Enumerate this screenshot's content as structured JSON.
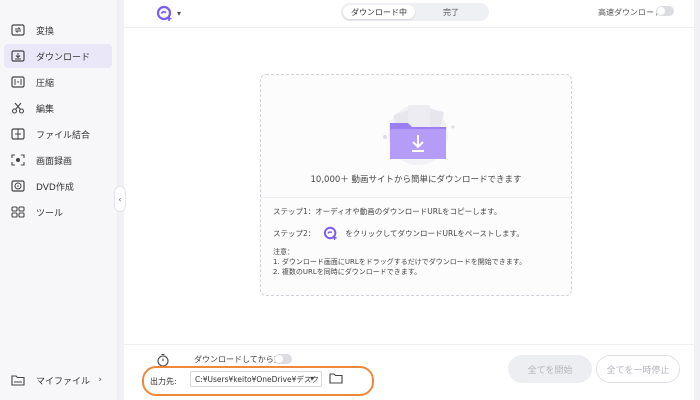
{
  "sidebar": {
    "items": [
      {
        "label": "変換",
        "icon": "convert-icon"
      },
      {
        "label": "ダウンロード",
        "icon": "download-icon",
        "active": true
      },
      {
        "label": "圧縮",
        "icon": "compress-icon"
      },
      {
        "label": "編集",
        "icon": "scissors-icon"
      },
      {
        "label": "ファイル結合",
        "icon": "merge-icon"
      },
      {
        "label": "画面録画",
        "icon": "screen-record-icon"
      },
      {
        "label": "DVD作成",
        "icon": "dvd-icon"
      },
      {
        "label": "ツール",
        "icon": "tools-icon"
      }
    ],
    "my_files": {
      "label": "マイファイル",
      "chevron": "›"
    },
    "collapse_glyph": "‹"
  },
  "header": {
    "tabs": [
      {
        "label": "ダウンロード中",
        "active": true
      },
      {
        "label": "完了",
        "active": false
      }
    ],
    "high_speed_label": "高速ダウンロード",
    "add_dropdown_glyph": "▾"
  },
  "dropzone": {
    "title": "10,000＋ 動画サイトから簡単にダウンロードできます",
    "step1": "ステップ1：オーディオや動画のダウンロードURLをコピーします。",
    "step2_prefix": "ステップ2：",
    "step2_text": "をクリックしてダウンロードURLをペーストします。",
    "notes": {
      "heading": "注意：",
      "line1": "1. ダウンロード画面にURLをドラッグするだけでダウンロードを開始できます。",
      "line2": "2. 複数のURLを同時にダウンロードできます。"
    }
  },
  "footer": {
    "download_then_convert": "ダウンロードしてから変換",
    "output_label": "出力先:",
    "output_path": "C:¥Users¥keito¥OneDrive¥デスク",
    "path_dropdown_glyph": "▾",
    "start_all": "全てを開始",
    "pause_all": "全てを一時停止"
  },
  "colors": {
    "accent": "#7b5cf0",
    "highlight": "#f0883b"
  }
}
